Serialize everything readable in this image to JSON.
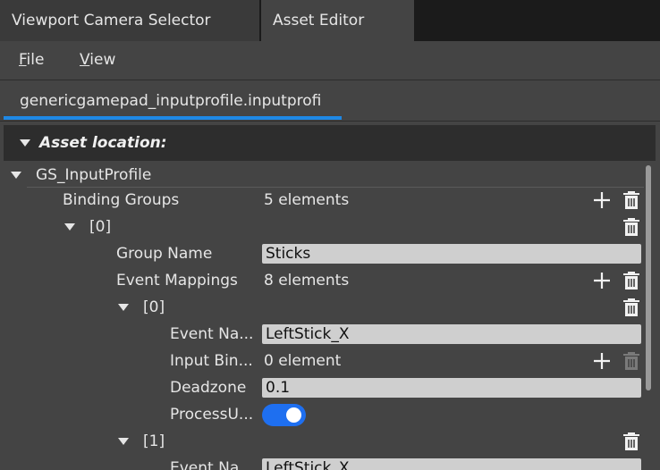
{
  "tabs": [
    {
      "label": "Viewport Camera Selector",
      "active": false
    },
    {
      "label": "Asset Editor",
      "active": true
    }
  ],
  "menu": {
    "file": {
      "mnemonic": "F",
      "rest": "ile"
    },
    "view": {
      "mnemonic": "V",
      "rest": "iew"
    }
  },
  "file_tab": {
    "label": "genericgamepad_inputprofile.inputprofi"
  },
  "asset_location": {
    "label": "Asset location:"
  },
  "tree": {
    "root": {
      "label": "GS_InputProfile"
    },
    "binding_groups": {
      "label": "Binding Groups",
      "value": "5 elements"
    },
    "group0": {
      "label": "[0]"
    },
    "group_name": {
      "label": "Group Name",
      "value": "Sticks"
    },
    "event_mappings": {
      "label": "Event Mappings",
      "value": "8 elements"
    },
    "mapping0": {
      "label": "[0]"
    },
    "event_name": {
      "label": "Event Na...",
      "value": "LeftStick_X"
    },
    "input_bindings": {
      "label": "Input Bin...",
      "value": "0 element"
    },
    "deadzone": {
      "label": "Deadzone",
      "value": "0.1"
    },
    "process_update": {
      "label": "ProcessU...",
      "enabled": true
    },
    "mapping1": {
      "label": "[1]"
    },
    "event_name_2": {
      "label": "Event Na...",
      "value": "LeftStick_X"
    }
  },
  "colors": {
    "accent": "#1e88e5",
    "toggle_on": "#1e6ff0",
    "background": "#444444",
    "header": "#2d2d2d"
  },
  "icons": {
    "add": "plus-icon",
    "delete": "trash-icon",
    "expand": "triangle-down-icon"
  }
}
